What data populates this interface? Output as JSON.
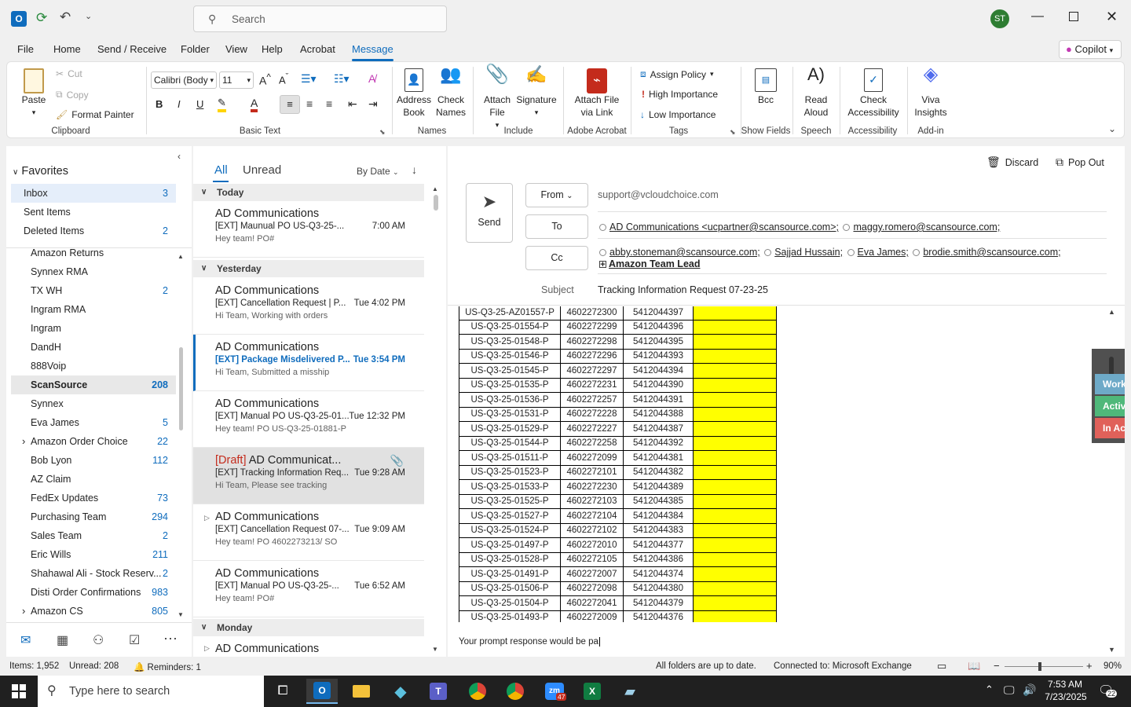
{
  "titlebar": {
    "search_placeholder": "Search",
    "avatar_initials": "ST"
  },
  "menu": {
    "items": [
      "File",
      "Home",
      "Send / Receive",
      "Folder",
      "View",
      "Help",
      "Acrobat",
      "Message"
    ],
    "active": "Message",
    "copilot": "Copilot"
  },
  "ribbon": {
    "clipboard": {
      "paste": "Paste",
      "cut": "Cut",
      "copy": "Copy",
      "format_painter": "Format Painter",
      "label": "Clipboard"
    },
    "basic_text": {
      "font": "Calibri (Body",
      "size": "11",
      "label": "Basic Text",
      "bold": "B",
      "italic": "I",
      "underline": "U"
    },
    "names": {
      "address_book": "Address Book",
      "check_names": "Check Names",
      "label": "Names"
    },
    "include": {
      "attach_file": "Attach File",
      "signature": "Signature",
      "label": "Include"
    },
    "acrobat": {
      "attach_link": "Attach File via Link",
      "label": "Adobe Acrobat"
    },
    "tags": {
      "assign_policy": "Assign Policy",
      "high_importance": "High Importance",
      "low_importance": "Low Importance",
      "label": "Tags"
    },
    "show_fields": {
      "bcc": "Bcc",
      "label": "Show Fields"
    },
    "speech": {
      "read_aloud": "Read Aloud",
      "label": "Speech"
    },
    "accessibility": {
      "check": "Check Accessibility",
      "label": "Accessibility"
    },
    "addin": {
      "viva": "Viva Insights",
      "label": "Add-in"
    }
  },
  "nav": {
    "favorites_label": "Favorites",
    "favorites": [
      {
        "name": "Inbox",
        "count": "3"
      },
      {
        "name": "Sent Items",
        "count": ""
      },
      {
        "name": "Deleted Items",
        "count": "2"
      }
    ],
    "folders": [
      {
        "name": "Amazon Returns",
        "count": ""
      },
      {
        "name": "Synnex RMA",
        "count": ""
      },
      {
        "name": "TX WH",
        "count": "2"
      },
      {
        "name": "Ingram RMA",
        "count": ""
      },
      {
        "name": "Ingram",
        "count": ""
      },
      {
        "name": "DandH",
        "count": ""
      },
      {
        "name": "888Voip",
        "count": ""
      },
      {
        "name": "ScanSource",
        "count": "208"
      },
      {
        "name": "Synnex",
        "count": ""
      },
      {
        "name": "Eva James",
        "count": "5"
      },
      {
        "name": "Amazon Order Choice",
        "count": "22"
      },
      {
        "name": "Bob Lyon",
        "count": "112"
      },
      {
        "name": "AZ Claim",
        "count": ""
      },
      {
        "name": "FedEx Updates",
        "count": "73"
      },
      {
        "name": "Purchasing Team",
        "count": "294"
      },
      {
        "name": "Sales Team",
        "count": "2"
      },
      {
        "name": "Eric Wills",
        "count": "211"
      },
      {
        "name": "Shahawal Ali - Stock Reserv...",
        "count": "2"
      },
      {
        "name": "Disti Order Confirmations",
        "count": "983"
      },
      {
        "name": "Amazon CS",
        "count": "805"
      }
    ]
  },
  "list": {
    "tab_all": "All",
    "tab_unread": "Unread",
    "sort": "By Date",
    "groups": {
      "today": "Today",
      "yesterday": "Yesterday",
      "monday": "Monday"
    },
    "items": [
      {
        "draft": "",
        "sender": "AD Communications",
        "subject": "[EXT] Maunual  PO   US-Q3-25-...",
        "time": "7:00 AM",
        "preview": "Hey team!  PO#"
      },
      {
        "draft": "",
        "sender": "AD Communications",
        "subject": "[EXT] Cancellation Request | P...",
        "time": "Tue 4:02 PM",
        "preview": "Hi Team,   Working with orders"
      },
      {
        "draft": "",
        "sender": "AD Communications",
        "subject": "[EXT] Package Misdelivered P...",
        "time": "Tue 3:54 PM",
        "preview": "Hi Team,   Submitted a misship"
      },
      {
        "draft": "",
        "sender": "AD Communications",
        "subject": "[EXT] Manual PO   US-Q3-25-01...",
        "time": "Tue 12:32 PM",
        "preview": "Hey team!  PO US-Q3-25-01881-P"
      },
      {
        "draft": "[Draft]",
        "sender": " AD Communicat...",
        "subject": "[EXT] Tracking Information Req...",
        "time": "Tue 9:28 AM",
        "preview": "Hi Team,   Please see tracking"
      },
      {
        "draft": "",
        "sender": "AD Communications",
        "subject": "[EXT] Cancellation Request  07-...",
        "time": "Tue 9:09 AM",
        "preview": "Hey team!  PO 4602273213/ SO"
      },
      {
        "draft": "",
        "sender": "AD Communications",
        "subject": "[EXT] Manual PO    US-Q3-25-...",
        "time": "Tue 6:52 AM",
        "preview": "Hey team!  PO#"
      },
      {
        "draft": "",
        "sender": "AD Communications",
        "subject": "",
        "time": "",
        "preview": ""
      }
    ]
  },
  "compose": {
    "discard": "Discard",
    "pop_out": "Pop Out",
    "send": "Send",
    "from_btn": "From",
    "from_value": "support@vcloudchoice.com",
    "to_btn": "To",
    "cc_btn": "Cc",
    "to": [
      "AD Communications <ucpartner@scansource.com>;",
      "maggy.romero@scansource.com;"
    ],
    "cc": [
      "abby.stoneman@scansource.com;",
      "Sajjad Hussain;",
      "Eva James;",
      "brodie.smith@scansource.com;"
    ],
    "cc_group": "Amazon Team Lead",
    "subject_label": "Subject",
    "subject": "Tracking Information Request   07-23-25",
    "body_text": "Your prompt response would be pa",
    "table": [
      [
        "US-Q3-25-AZ01557-P",
        "4602272300",
        "5412044397"
      ],
      [
        "US-Q3-25-01554-P",
        "4602272299",
        "5412044396"
      ],
      [
        "US-Q3-25-01548-P",
        "4602272298",
        "5412044395"
      ],
      [
        "US-Q3-25-01546-P",
        "4602272296",
        "5412044393"
      ],
      [
        "US-Q3-25-01545-P",
        "4602272297",
        "5412044394"
      ],
      [
        "US-Q3-25-01535-P",
        "4602272231",
        "5412044390"
      ],
      [
        "US-Q3-25-01536-P",
        "4602272257",
        "5412044391"
      ],
      [
        "US-Q3-25-01531-P",
        "4602272228",
        "5412044388"
      ],
      [
        "US-Q3-25-01529-P",
        "4602272227",
        "5412044387"
      ],
      [
        "US-Q3-25-01544-P",
        "4602272258",
        "5412044392"
      ],
      [
        "US-Q3-25-01511-P",
        "4602272099",
        "5412044381"
      ],
      [
        "US-Q3-25-01523-P",
        "4602272101",
        "5412044382"
      ],
      [
        "US-Q3-25-01533-P",
        "4602272230",
        "5412044389"
      ],
      [
        "US-Q3-25-01525-P",
        "4602272103",
        "5412044385"
      ],
      [
        "US-Q3-25-01527-P",
        "4602272104",
        "5412044384"
      ],
      [
        "US-Q3-25-01524-P",
        "4602272102",
        "5412044383"
      ],
      [
        "US-Q3-25-01497-P",
        "4602272010",
        "5412044377"
      ],
      [
        "US-Q3-25-01528-P",
        "4602272105",
        "5412044386"
      ],
      [
        "US-Q3-25-01491-P",
        "4602272007",
        "5412044374"
      ],
      [
        "US-Q3-25-01506-P",
        "4602272098",
        "5412044380"
      ],
      [
        "US-Q3-25-01504-P",
        "4602272041",
        "5412044379"
      ],
      [
        "US-Q3-25-01493-P",
        "4602272009",
        "5412044376"
      ]
    ],
    "side_panel": [
      "Worki",
      "Active",
      "In Acti"
    ]
  },
  "status": {
    "items": "Items: 1,952",
    "unread": "Unread: 208",
    "reminders": "Reminders: 1",
    "sync": "All folders are up to date.",
    "connected": "Connected to: Microsoft Exchange",
    "zoom": "90%"
  },
  "taskbar": {
    "search_placeholder": "Type here to search",
    "time": "7:53 AM",
    "date": "7/23/2025",
    "zoom_badge": "47",
    "notif_count": "22"
  },
  "colors": {
    "accent": "#0f6cbd",
    "highlight": "#ffff00",
    "taskbar": "#202020"
  }
}
